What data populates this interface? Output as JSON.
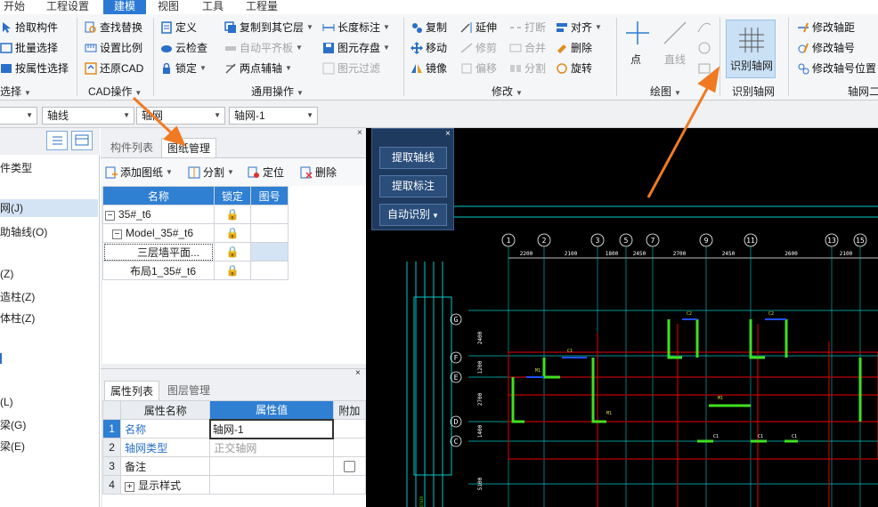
{
  "menu": {
    "items": [
      "开始",
      "工程设置",
      "建模",
      "视图",
      "工具",
      "工程量"
    ],
    "active": "建模"
  },
  "ribbon": {
    "select": {
      "pick": "拾取构件",
      "batch": "批量选择",
      "by_attr": "按属性选择",
      "group": "选择"
    },
    "cad": {
      "find_replace": "查找替换",
      "set_scale": "设置比例",
      "restore_cad": "还原CAD",
      "group": "CAD操作"
    },
    "common": {
      "define": "定义",
      "cloud_check": "云检查",
      "lock": "锁定",
      "copy_layer": "复制到其它层",
      "auto_flat": "自动平齐板",
      "two_point_axis": "两点辅轴",
      "length_dim": "长度标注",
      "element_save": "图元存盘",
      "element_filter": "图元过滤",
      "group": "通用操作"
    },
    "modify": {
      "copy": "复制",
      "move": "移动",
      "mirror": "镜像",
      "extend": "延伸",
      "trim": "修剪",
      "offset": "偏移",
      "break": "打断",
      "merge": "合并",
      "split": "分割",
      "align": "对齐",
      "delete": "删除",
      "rotate": "旋转",
      "group": "修改"
    },
    "draw": {
      "point": "点",
      "line": "直线",
      "group": "绘图"
    },
    "identify": {
      "btn": "识别轴网",
      "group": "识别轴网"
    },
    "axisgrid2": {
      "modify_spacing": "修改轴距",
      "modify_number": "修改轴号",
      "modify_number_pos": "修改轴号位置",
      "group": "轴网二次"
    }
  },
  "toolbar2": {
    "dd0": "",
    "dd1": "轴线",
    "dd2": "轴网",
    "dd3": "轴网-1"
  },
  "left": {
    "items": [
      "件类型",
      "网(J)",
      "助轴线(O)",
      "(Z)",
      "造柱(Z)",
      "体柱(Z)",
      "(L)",
      "梁(G)",
      "梁(E)"
    ]
  },
  "drawing": {
    "tabs": [
      "构件列表",
      "图纸管理"
    ],
    "toolbar": {
      "add": "添加图纸",
      "split": "分割",
      "locate": "定位",
      "delete": "删除"
    },
    "headers": [
      "名称",
      "锁定",
      "图号"
    ],
    "rows": [
      {
        "name": "35#_t6",
        "toggle": "−"
      },
      {
        "name": "Model_35#_t6",
        "toggle": "−"
      },
      {
        "name": "三层墙平面...",
        "toggle": ""
      },
      {
        "name": "布局1_35#_t6",
        "toggle": ""
      }
    ]
  },
  "props": {
    "tabs": [
      "属性列表",
      "图层管理"
    ],
    "headers": [
      "属性名称",
      "属性值",
      "附加"
    ],
    "rows": [
      {
        "no": "1",
        "name": "名称",
        "value": "轴网-1"
      },
      {
        "no": "2",
        "name": "轴网类型",
        "value": "正交轴网"
      },
      {
        "no": "3",
        "name": "备注",
        "value": ""
      },
      {
        "no": "4",
        "name": "显示样式",
        "value": ""
      }
    ]
  },
  "float": {
    "extract_axis": "提取轴线",
    "extract_dim": "提取标注",
    "auto_identify": "自动识别"
  },
  "chart_data": {
    "axis_numbers": [
      "1",
      "2",
      "3",
      "5",
      "7",
      "9",
      "11",
      "13",
      "15"
    ],
    "dims": [
      "2200",
      "2100",
      "1800",
      "2450",
      "2700",
      "2450",
      "2600",
      "2100"
    ],
    "row_labels": [
      "G",
      "F",
      "E",
      "D",
      "C"
    ],
    "row_dims": [
      "2400",
      "1200",
      "2700",
      "1400",
      "5100"
    ]
  }
}
